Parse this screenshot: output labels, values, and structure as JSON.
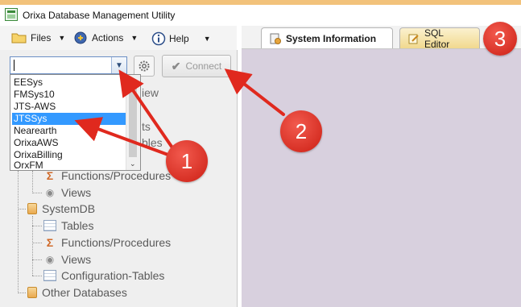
{
  "window": {
    "title": "Orixa Database Management Utility"
  },
  "menubar": {
    "files": "Files",
    "actions": "Actions",
    "help": "Help"
  },
  "toolbar": {
    "combo_value": "",
    "connect_label": "Connect"
  },
  "dropdown": {
    "items": [
      "EESys",
      "FMSys10",
      "JTS-AWS",
      "JTSSys",
      "Nearearth",
      "OrixaAWS",
      "OrixaBilling",
      "OrxFM"
    ],
    "selected": "JTSSys"
  },
  "tree_partial": [
    "iew",
    "ts",
    "bles"
  ],
  "tree": {
    "functions_procedures": "Functions/Procedures",
    "views": "Views",
    "systemdb": "SystemDB",
    "sys_tables": "Tables",
    "sys_functions_procedures": "Functions/Procedures",
    "sys_views": "Views",
    "sys_configuration_tables": "Configuration-Tables",
    "other_databases": "Other Databases"
  },
  "tabs": {
    "system_information": "System Information",
    "sql_editor": "SQL Editor"
  },
  "annotations": {
    "badge1": "1",
    "badge2": "2",
    "badge3": "3"
  },
  "colors": {
    "annotation_red": "#e0291e",
    "selection_blue": "#3399ff",
    "workspace": "#d8d0de"
  }
}
